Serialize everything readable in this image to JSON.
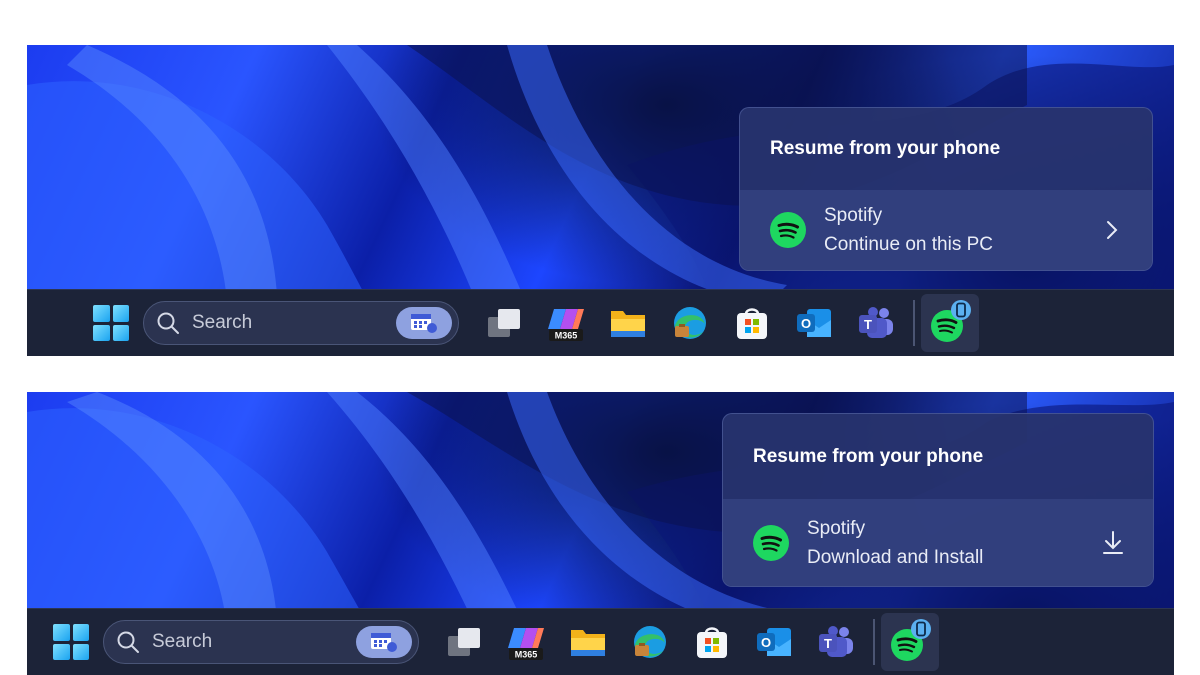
{
  "screens": [
    {
      "flyout": {
        "title": "Resume from your phone",
        "app_name": "Spotify",
        "app_action": "Continue on this PC",
        "action_icon": "chevron-right-icon"
      },
      "taskbar": {
        "search_placeholder": "Search",
        "copilot_badge": "M365",
        "teams_letter": "T",
        "outlook_letter": "O"
      }
    },
    {
      "flyout": {
        "title": "Resume from your phone",
        "app_name": "Spotify",
        "app_action": "Download and Install",
        "action_icon": "download-icon"
      },
      "taskbar": {
        "search_placeholder": "Search",
        "copilot_badge": "M365",
        "teams_letter": "T",
        "outlook_letter": "O"
      }
    }
  ],
  "colors": {
    "spotify_green": "#1ed760",
    "taskbar_bg": "#1c2338",
    "flyout_bg": "#28346e"
  }
}
